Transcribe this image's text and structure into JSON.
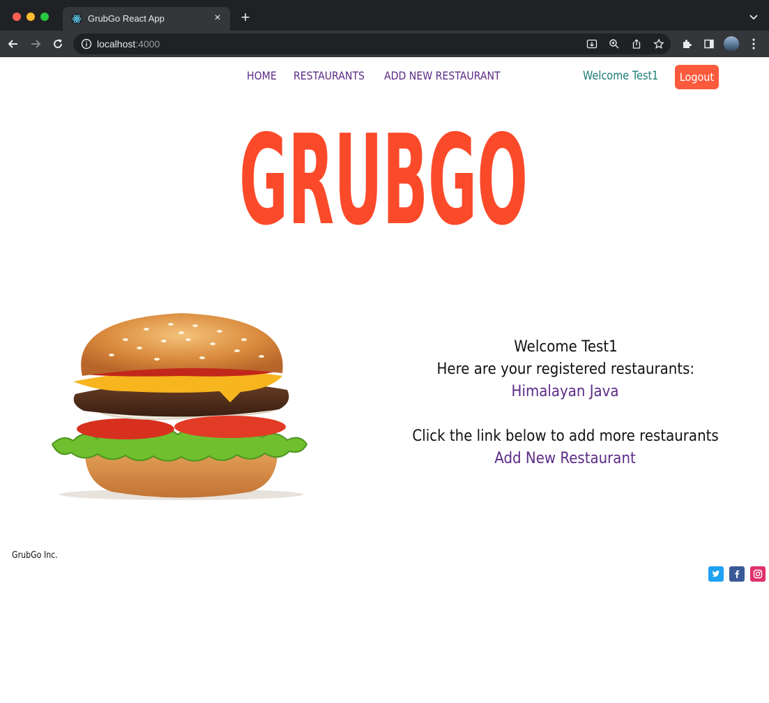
{
  "browser": {
    "tab_title": "GrubGo React App",
    "url_host": "localhost",
    "url_port": ":4000",
    "tab_close_symbol": "×",
    "new_tab_symbol": "+"
  },
  "nav": {
    "links": [
      "HOME",
      "RESTAURANTS",
      "ADD NEW RESTAURANT"
    ],
    "welcome": "Welcome Test1",
    "logout_label": "Logout"
  },
  "hero": {
    "logo_text": "GRUBGO"
  },
  "main": {
    "welcome": "Welcome Test1",
    "registered_intro": "Here are your registered restaurants:",
    "restaurants": [
      "Himalayan Java"
    ],
    "add_prompt": "Click the link below to add more restaurants",
    "add_link": "Add New Restaurant"
  },
  "footer": {
    "company": "GrubGo Inc.",
    "social": [
      "twitter-icon",
      "facebook-icon",
      "instagram-icon"
    ]
  },
  "colors": {
    "brand_orange": "#fb4a2a",
    "nav_purple": "#5b2a86",
    "welcome_teal": "#1a7a75",
    "logout_bg": "#fb5a3d",
    "twitter": "#1da1f2",
    "facebook": "#3b5998",
    "instagram": "#e1306c"
  }
}
